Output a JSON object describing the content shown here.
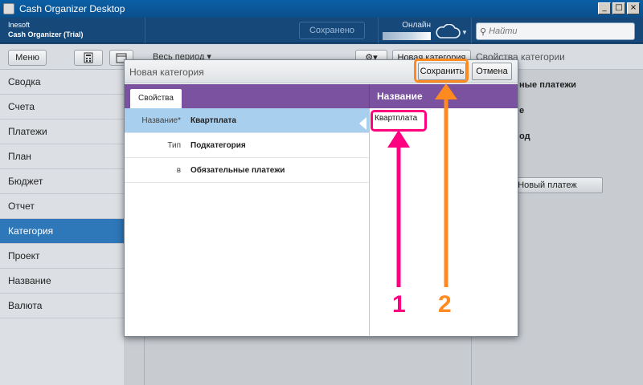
{
  "window": {
    "title": "Cash Organizer Desktop",
    "controls": [
      "_",
      "□",
      "×"
    ]
  },
  "header": {
    "company": "Inesoft",
    "product": "Cash Organizer (Trial)",
    "sync_status": "Сохранено",
    "online_label": "Онлайн",
    "search_placeholder": "Найти"
  },
  "toolbar": {
    "menu_label": "Меню",
    "period_label": "Весь период ▾",
    "new_category_label": "Новая категория",
    "right_panel_title": "Свойства категории"
  },
  "sidebar": {
    "items": [
      {
        "label": "Сводка"
      },
      {
        "label": "Счета"
      },
      {
        "label": "Платежи"
      },
      {
        "label": "План"
      },
      {
        "label": "Бюджет"
      },
      {
        "label": "Отчет"
      },
      {
        "label": "Категория",
        "active": true
      },
      {
        "label": "Проект"
      },
      {
        "label": "Название"
      },
      {
        "label": "Валюта"
      }
    ]
  },
  "right_panel": {
    "line1": "ные платежи",
    "line2": "е",
    "line3": "од",
    "new_payment_button": "Новый платеж"
  },
  "modal": {
    "title": "Новая категория",
    "save_label": "Сохранить",
    "cancel_label": "Отмена",
    "tab_label": "Свойства",
    "props_header": "Название",
    "rows": [
      {
        "key": "Название*",
        "value": "Квартплата",
        "selected": true
      },
      {
        "key": "Тип",
        "value": "Подкатегория"
      },
      {
        "key": "в",
        "value": "Обязательные платежи"
      }
    ],
    "edit_value": "Квартплата"
  },
  "annotations": {
    "label1": "1",
    "label2": "2",
    "color1": "#ff0080",
    "color2": "#ff8a1f"
  }
}
